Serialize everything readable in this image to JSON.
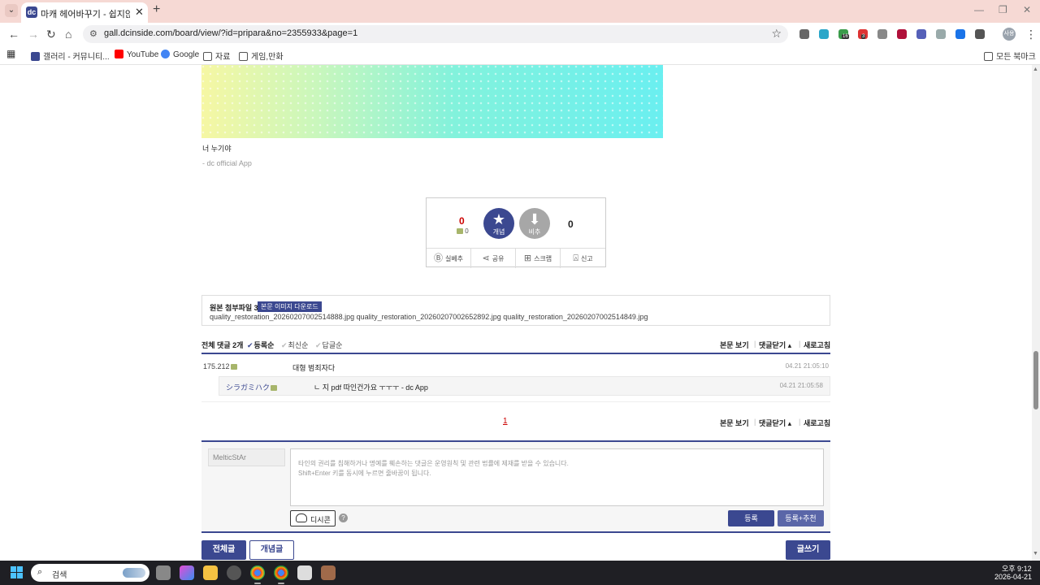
{
  "browser": {
    "tab_title": "마캐 헤어바꾸기 - 쉽지않음 -",
    "favicon_letter": "dc",
    "tab_close": "✕",
    "new_tab": "+",
    "url": "gall.dcinside.com/board/view/?id=pripara&no=2355933&page=1",
    "window_controls": [
      "—",
      "❐",
      "✕"
    ],
    "extension_badges": [
      "16",
      "3"
    ],
    "profile_label": "사용"
  },
  "bookmarks": [
    {
      "label": "갤러리 - 커뮤니티...",
      "icon": "dc-icon",
      "color": "#3b4890"
    },
    {
      "label": "YouTube",
      "icon": "youtube-icon",
      "color": "#ff0000"
    },
    {
      "label": "Google",
      "icon": "google-icon",
      "color": "#4285f4"
    },
    {
      "label": "자료",
      "icon": "folder-icon",
      "color": "#555555"
    },
    {
      "label": "게임,만화",
      "icon": "folder-icon",
      "color": "#555555"
    }
  ],
  "all_bookmarks_label": "모든 북마크",
  "post": {
    "text": "너 누기야",
    "signature": "- dc official App"
  },
  "vote": {
    "up_count": "0",
    "fixed_count": "0",
    "up_label": "개념",
    "down_label": "비추",
    "down_count": "0",
    "actions": [
      {
        "label": "실베추",
        "icon": "b-icon"
      },
      {
        "label": "공유",
        "icon": "share-icon"
      },
      {
        "label": "스크랩",
        "icon": "scrap-icon"
      },
      {
        "label": "신고",
        "icon": "siren-icon"
      }
    ]
  },
  "attachments": {
    "title": "원본 첨부파일 3",
    "download_label": "본문 이미지 다운로드",
    "files": "quality_restoration_20260207002514888.jpg  quality_restoration_20260207002652892.jpg  quality_restoration_20260207002514849.jpg"
  },
  "comments": {
    "total_label": "전체 댓글 2개",
    "sort_options": [
      "등록순",
      "최신순",
      "답글순"
    ],
    "header_links": [
      "본문 보기",
      "댓글닫기 ▴",
      "새로고침"
    ],
    "items": [
      {
        "author": "175.212",
        "text": "대형 범죄자다",
        "date": "04.21 21:05:10"
      }
    ],
    "reply": {
      "author": "シラガミハク",
      "text": "ㄴ 지 pdf 따인건가요 ㅜㅜㅜ - dc App",
      "date": "04.21 21:05:58"
    },
    "page": "1"
  },
  "write": {
    "nickname": "MelticStAr",
    "placeholder_1": "타인의 권리를 침해하거나 명예를 훼손하는 댓글은 운영원칙 및 관련 법률에 제재를 받을 수 있습니다.",
    "placeholder_2": "Shift+Enter 키를 동시에 누르면 줄바꿈이 됩니다.",
    "dccon_label": "디시콘",
    "help": "?",
    "submit_label": "등록",
    "submit_recommend_label": "등록+추천"
  },
  "bottom": {
    "all_posts": "전체글",
    "concept_posts": "개념글",
    "write": "글쓰기"
  },
  "taskbar": {
    "search_placeholder": "검색",
    "time": "오후 9:12",
    "date": "2026-04-21"
  },
  "colors": {
    "dc_accent": "#3b4890",
    "upvote_count": "#cc0000"
  }
}
